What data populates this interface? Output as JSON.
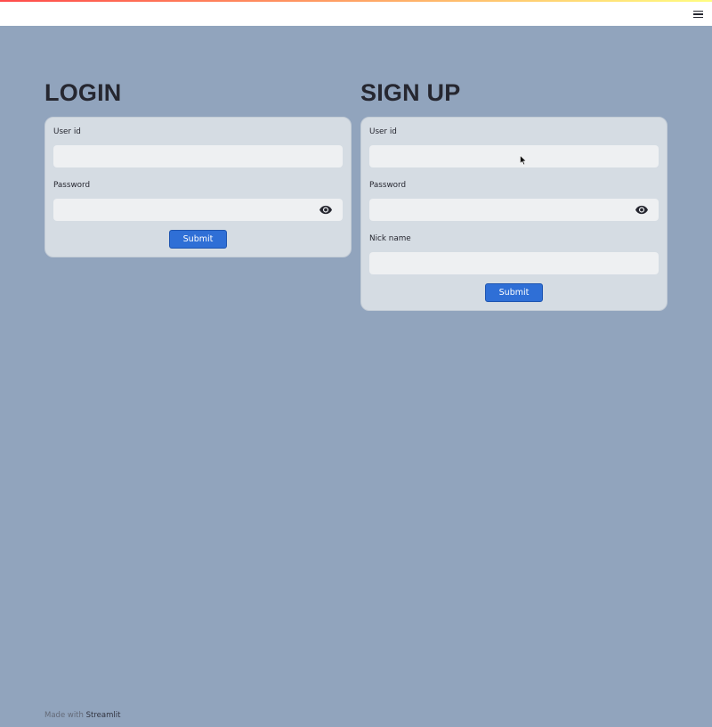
{
  "header": {
    "menu_icon": "hamburger-icon"
  },
  "login": {
    "title": "LOGIN",
    "user_id_label": "User id",
    "user_id_value": "",
    "password_label": "Password",
    "password_value": "",
    "submit_label": "Submit"
  },
  "signup": {
    "title": "SIGN UP",
    "user_id_label": "User id",
    "user_id_value": "",
    "password_label": "Password",
    "password_value": "",
    "nickname_label": "Nick name",
    "nickname_value": "",
    "submit_label": "Submit"
  },
  "footer": {
    "made_with": "Made with",
    "brand": "Streamlit"
  },
  "colors": {
    "background": "#91a4bd",
    "accent": "#2f6fd6",
    "form_bg": "#d5dce3"
  }
}
